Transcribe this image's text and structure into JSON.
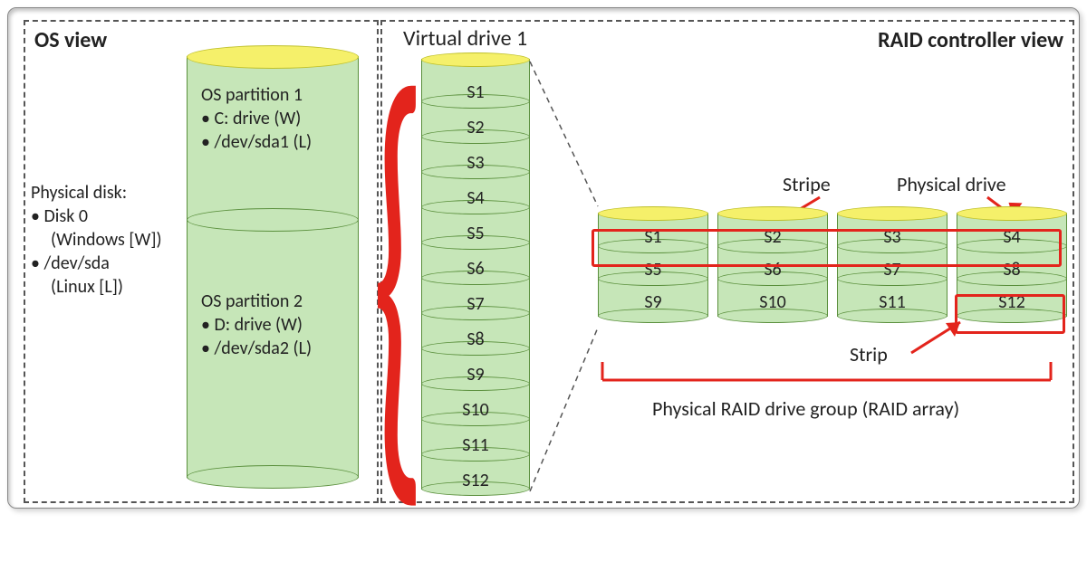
{
  "os_panel": {
    "title": "OS view",
    "physical_disk_title": "Physical disk:",
    "physical_disk_items": [
      "Disk 0",
      "(Windows [W])",
      "/dev/sda",
      "(Linux [L])"
    ],
    "partition1": {
      "title": "OS partition 1",
      "items": [
        "C: drive (W)",
        "/dev/sda1 (L)"
      ]
    },
    "partition2": {
      "title": "OS partition 2",
      "items": [
        "D: drive (W)",
        "/dev/sda2 (L)"
      ]
    }
  },
  "vd": {
    "title": "Virtual drive 1",
    "segments": [
      "S1",
      "S2",
      "S3",
      "S4",
      "S5",
      "S6",
      "S7",
      "S8",
      "S9",
      "S10",
      "S11",
      "S12"
    ]
  },
  "raid_panel": {
    "title": "RAID controller view",
    "stripe_label": "Stripe",
    "physical_drive_label": "Physical drive",
    "strip_label": "Strip",
    "group_label": "Physical RAID drive group (RAID array)",
    "drives": [
      {
        "cells": [
          "S1",
          "S5",
          "S9"
        ]
      },
      {
        "cells": [
          "S2",
          "S6",
          "S10"
        ]
      },
      {
        "cells": [
          "S3",
          "S7",
          "S11"
        ]
      },
      {
        "cells": [
          "S4",
          "S8",
          "S12"
        ]
      }
    ]
  }
}
